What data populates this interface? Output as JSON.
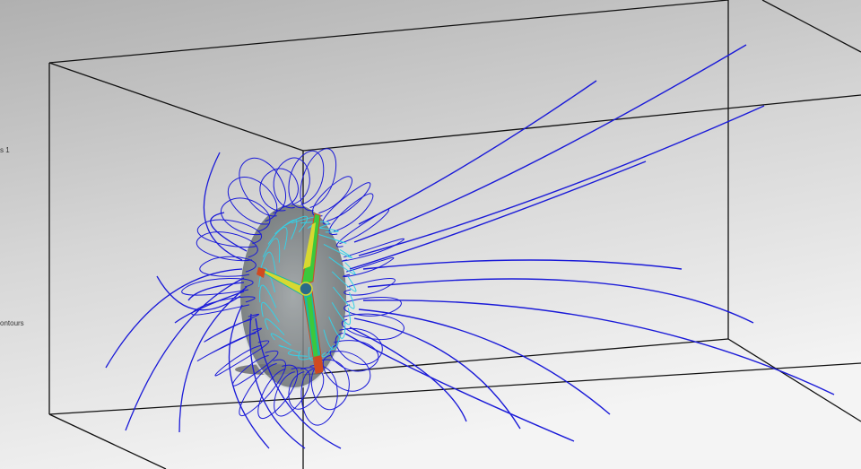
{
  "panel": {
    "label_1": "s 1",
    "label_2": "ontours"
  },
  "scene": {
    "description_type": "3D flow simulation viewport",
    "background_top": "#b3b3b3",
    "background_bottom": "#f2f2f2",
    "box_edge_color": "#111111",
    "streamline_color": "#1a1ad8",
    "streamline_highlight_color": "#35d0e6",
    "rotor_colors": [
      "#1db8a0",
      "#3cc83c",
      "#d8d830",
      "#d04a20"
    ]
  }
}
